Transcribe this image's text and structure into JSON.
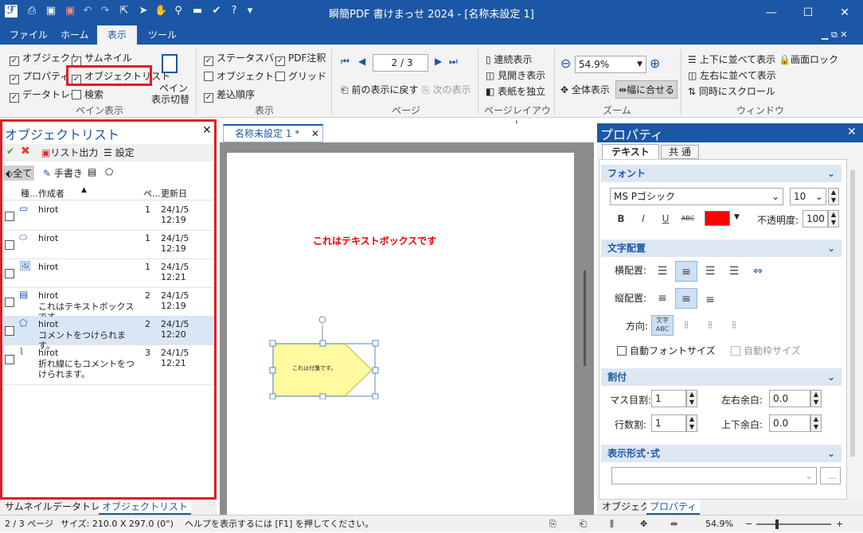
{
  "window": {
    "title": "瞬簡PDF 書けまっせ 2024 - [名称未設定 1]",
    "minimize": "—",
    "maximize": "☐",
    "close": "✕"
  },
  "menu": {
    "file": "ファイル",
    "home": "ホーム",
    "view": "表示",
    "tools": "ツール",
    "restore": "▁ ⧉ ✕"
  },
  "ribbon": {
    "pane": {
      "object": "オブジェクト",
      "thumbnail": "サムネイル",
      "property": "プロパティ",
      "object_list": "オブジェクトリスト",
      "data_tray": "データトレー",
      "search": "検索",
      "pane_switch_1": "ペイン",
      "pane_switch_2": "表示切替",
      "group": "ペイン表示"
    },
    "display": {
      "status_bar": "ステータスバー",
      "pdf_annot": "PDF注釈",
      "object_name": "オブジェクト名",
      "grid": "グリッド",
      "insert_order": "差込順序",
      "group": "表示"
    },
    "page": {
      "page_value": "2 / 3",
      "prev_view": "前の表示に戻す",
      "next_view": "次の表示",
      "group": "ページ"
    },
    "layout": {
      "continuous": "連続表示",
      "spread": "見開き表示",
      "cover": "表紙を独立",
      "group": "ページレイアウト"
    },
    "zoom": {
      "value": "54.9%",
      "full_view": "全体表示",
      "fit_width": "幅に合せる",
      "group": "ズーム"
    },
    "window": {
      "tile_vertical": "上下に並べて表示",
      "tile_horizontal": "左右に並べて表示",
      "sync_scroll": "同時にスクロール",
      "screen_lock": "画面ロック",
      "group": "ウィンドウ"
    }
  },
  "objlist": {
    "title": "オブジェクトリスト",
    "list_output": "リスト出力",
    "settings": "設定",
    "filter_all": "全て",
    "filter_hand": "手書き",
    "columns": {
      "type": "種...",
      "author": "作成者",
      "page": "ペ...",
      "updated": "更新日"
    },
    "rows": [
      {
        "author": "hirot",
        "text": "",
        "page": "1",
        "date": "24/1/5 12:19",
        "icon": "rounded-rect"
      },
      {
        "author": "hirot",
        "text": "",
        "page": "1",
        "date": "24/1/5 12:19",
        "icon": "ellipse"
      },
      {
        "author": "hirot",
        "text": "",
        "page": "1",
        "date": "24/1/5 12:21",
        "icon": "image"
      },
      {
        "author": "hirot",
        "text": "これはテキストボックスです",
        "page": "2",
        "date": "24/1/5 12:19",
        "icon": "textbox"
      },
      {
        "author": "hirot",
        "text": "コメントをつけられます。",
        "page": "2",
        "date": "24/1/5 12:20",
        "icon": "tag"
      },
      {
        "author": "hirot",
        "text": "折れ線にもコメントをつけられます。",
        "page": "3",
        "date": "24/1/5 12:21",
        "icon": "polyline"
      }
    ]
  },
  "doc": {
    "tab": "名称未設定 1 *",
    "textbox": "これはテキストボックスです",
    "tag_text": "これは付箋です。"
  },
  "props": {
    "title": "プロパティ",
    "tab_text": "テキスト",
    "tab_common": "共 通",
    "font": {
      "header": "フォント",
      "name": "MS Pゴシック",
      "size": "10",
      "bold": "B",
      "italic": "I",
      "underline": "U",
      "strike": "ABC",
      "opacity_label": "不透明度:",
      "opacity": "100",
      "color": "#ff0000"
    },
    "align": {
      "header": "文字配置",
      "horizontal": "横配置:",
      "vertical": "縦配置:",
      "direction": "方向:",
      "auto_font": "自動フォントサイズ",
      "auto_frame": "自動枠サイズ"
    },
    "split": {
      "header": "割付",
      "cell": "マス目割:",
      "cell_value": "1",
      "row": "行数割:",
      "row_value": "1",
      "lr_margin": "左右余白:",
      "lr_value": "0.0",
      "tb_margin": "上下余白:",
      "tb_value": "0.0"
    },
    "format": {
      "header": "表示形式･式",
      "more": "..."
    }
  },
  "bottom_tabs": {
    "thumbnail": "サムネイル",
    "data_tray": "データトレー",
    "object_list": "オブジェクトリスト",
    "object": "オブジェクト",
    "property": "プロパティ"
  },
  "status": {
    "page": "2 / 3 ページ",
    "size": "サイズ: 210.0 X 297.0 (0°)",
    "help": "ヘルプを表示するには [F1] を押してください。",
    "zoom": "54.9%"
  },
  "colors": {
    "accent": "#1c57a5",
    "highlight": "#e21c24"
  }
}
